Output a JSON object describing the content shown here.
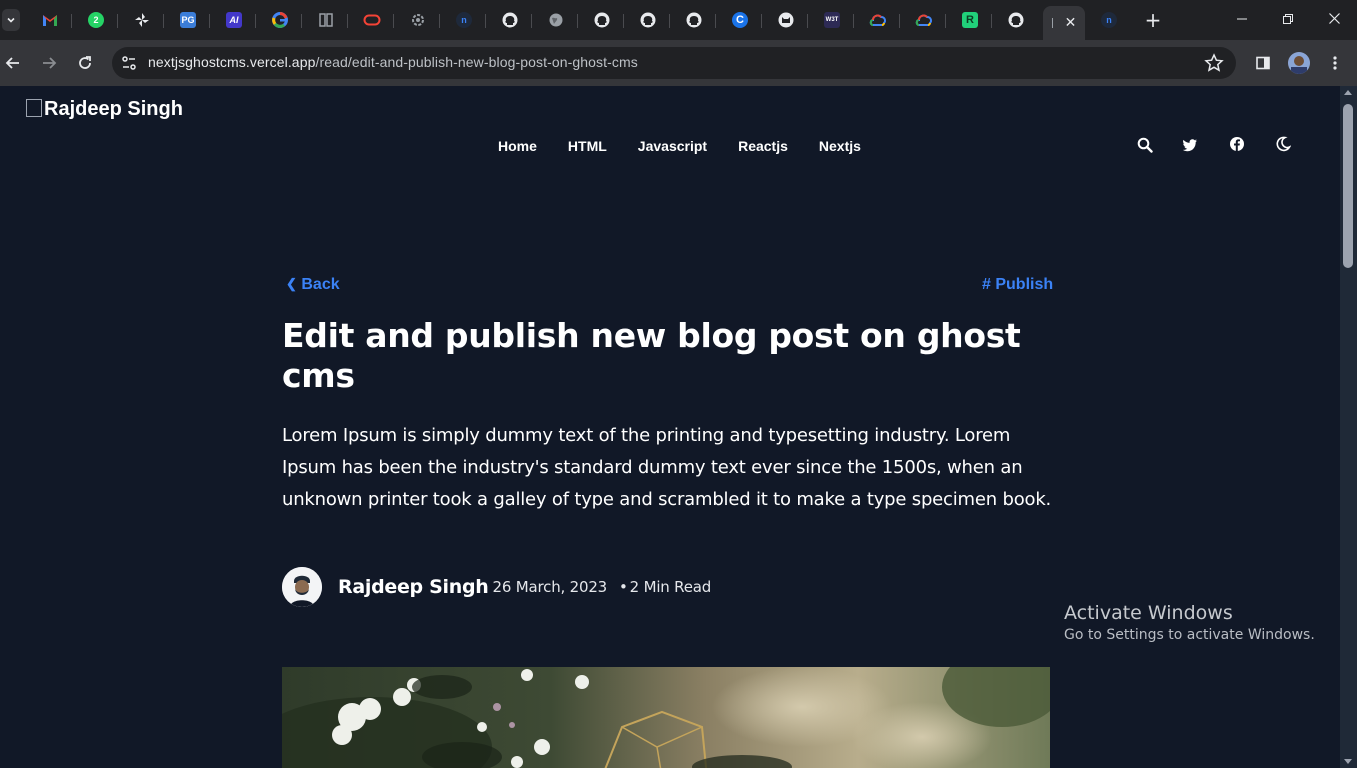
{
  "browser": {
    "tabs": [
      {
        "name": "tab-search-icon"
      },
      {
        "name": "gmail-icon"
      },
      {
        "name": "whatsapp-icon",
        "badge": "2"
      },
      {
        "name": "pinwheel-icon"
      },
      {
        "name": "pg-icon",
        "label": "PG"
      },
      {
        "name": "ai-icon",
        "label": "AI"
      },
      {
        "name": "google-icon"
      },
      {
        "name": "columns-icon"
      },
      {
        "name": "oracle-icon"
      },
      {
        "name": "gear-icon"
      },
      {
        "name": "n-icon"
      },
      {
        "name": "github-icon"
      },
      {
        "name": "globe-icon"
      },
      {
        "name": "github-icon"
      },
      {
        "name": "github-icon"
      },
      {
        "name": "github-icon"
      },
      {
        "name": "c-icon",
        "label": "C"
      },
      {
        "name": "cat-icon"
      },
      {
        "name": "w3-icon",
        "label": "W3T"
      },
      {
        "name": "gcloud-icon"
      },
      {
        "name": "gcloud-icon"
      },
      {
        "name": "r-icon",
        "label": "R"
      },
      {
        "name": "github-icon"
      }
    ],
    "url_host": "nextjsghostcms.vercel.app",
    "url_path": "/read/edit-and-publish-new-blog-post-on-ghost-cms"
  },
  "site": {
    "logo_alt": "Rajdeep Singh",
    "nav": [
      "Home",
      "HTML",
      "Javascript",
      "Reactjs",
      "Nextjs"
    ]
  },
  "post": {
    "back_label": "Back",
    "tag": "# Publish",
    "title": "Edit and publish new blog post on ghost cms",
    "excerpt": "Lorem Ipsum is simply dummy text of the printing and typesetting industry. Lorem Ipsum has been the industry's standard dummy text ever since the 1500s, when an unknown printer took a galley of type and scrambled it to make a type specimen book.",
    "author": "Rajdeep Singh",
    "date": "26 March, 2023",
    "read_time": "2 Min Read"
  },
  "os": {
    "activate_title": "Activate Windows",
    "activate_sub": "Go to Settings to activate Windows."
  },
  "colors": {
    "page_bg": "#111827",
    "accent": "#3b82f6",
    "chrome_dark": "#202124",
    "chrome_toolbar": "#35363a"
  }
}
